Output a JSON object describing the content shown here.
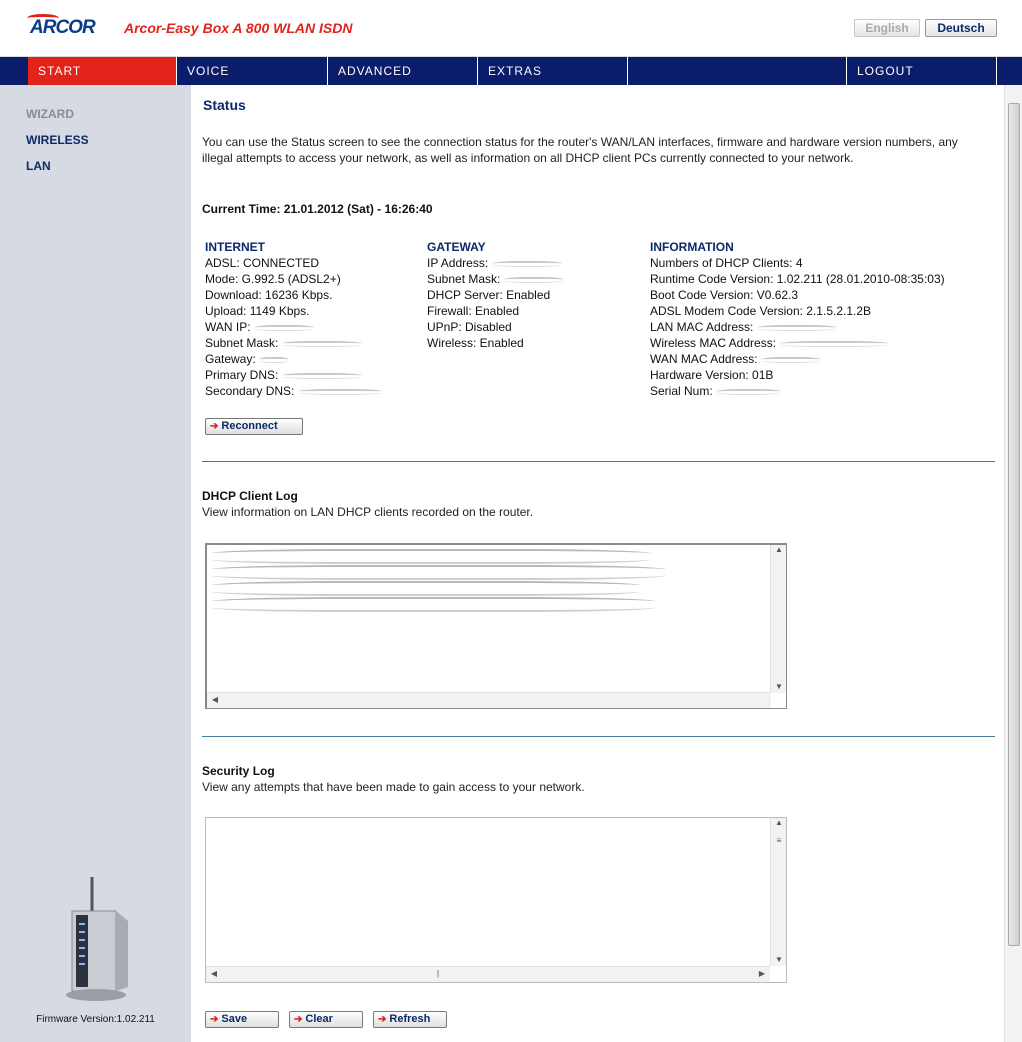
{
  "header": {
    "logo": "ARCOR",
    "product": "Arcor-Easy Box A 800 WLAN ISDN",
    "lang_en": "English",
    "lang_de": "Deutsch"
  },
  "nav": {
    "start": "START",
    "voice": "VOICE",
    "advanced": "ADVANCED",
    "extras": "EXTRAS",
    "logout": "LOGOUT"
  },
  "sidebar": {
    "items": [
      {
        "label": "WIZARD"
      },
      {
        "label": "WIRELESS"
      },
      {
        "label": "LAN"
      }
    ],
    "firmware": "Firmware Version:1.02.211"
  },
  "main": {
    "title": "Status",
    "intro": "You can use the Status screen to see the connection status for the router's WAN/LAN interfaces, firmware and hardware version numbers, any illegal attempts to access your network, as well as information on all DHCP client PCs currently connected to your network.",
    "current_time": "Current Time: 21.01.2012 (Sat) - 16:26:40",
    "internet": {
      "heading": "INTERNET",
      "adsl": "ADSL:  CONNECTED",
      "mode": "Mode:  G.992.5 (ADSL2+)",
      "download": "Download:  16236 Kbps.",
      "upload": "Upload:  1149 Kbps.",
      "wan_ip": "WAN IP:",
      "subnet": "Subnet Mask:",
      "gateway": "Gateway:",
      "primary_dns": "Primary DNS:",
      "secondary_dns": "Secondary DNS:"
    },
    "gateway": {
      "heading": "GATEWAY",
      "ip": "IP Address:",
      "subnet": "Subnet Mask:",
      "dhcp": "DHCP Server:  Enabled",
      "firewall": "Firewall:  Enabled",
      "upnp": "UPnP:  Disabled",
      "wireless": "Wireless:  Enabled"
    },
    "information": {
      "heading": "INFORMATION",
      "dhcp_clients": "Numbers of DHCP Clients:  4",
      "runtime": "Runtime Code Version:  1.02.211 (28.01.2010-08:35:03)",
      "boot": "Boot Code Version:  V0.62.3",
      "modem": "ADSL Modem Code Version:  2.1.5.2.1.2B",
      "lan_mac": "LAN MAC Address:",
      "wireless_mac": "Wireless MAC Address:",
      "wan_mac": "WAN MAC Address:",
      "hw": "Hardware Version:  01B",
      "serial": "Serial Num:"
    },
    "reconnect": "Reconnect",
    "dhcp_log_title": "DHCP Client Log",
    "dhcp_log_desc": "View information on LAN DHCP clients recorded on the router.",
    "security_log_title": "Security Log",
    "security_log_desc": "View any attempts that have been made to gain access to your network.",
    "save": "Save",
    "clear": "Clear",
    "refresh": "Refresh"
  }
}
